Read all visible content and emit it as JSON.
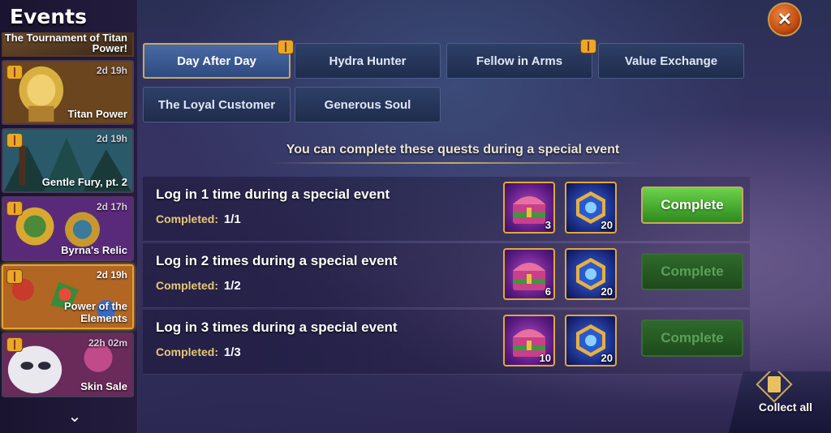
{
  "header": {
    "title": "Events"
  },
  "sidebar": {
    "items": [
      {
        "name": "The Tournament of Titan Power!",
        "timer": ""
      },
      {
        "name": "Titan Power",
        "timer": "2d 19h"
      },
      {
        "name": "Gentle Fury, pt. 2",
        "timer": "2d 19h"
      },
      {
        "name": "Byrna's Relic",
        "timer": "2d 17h"
      },
      {
        "name": "Power of the Elements",
        "timer": "2d 19h"
      },
      {
        "name": "Skin Sale",
        "timer": "22h 02m"
      }
    ]
  },
  "tabs": [
    {
      "label": "Day After Day",
      "active": true,
      "gift": true
    },
    {
      "label": "Hydra Hunter",
      "active": false,
      "gift": false
    },
    {
      "label": "Fellow in Arms",
      "active": false,
      "gift": true
    },
    {
      "label": "Value Exchange",
      "active": false,
      "gift": false
    },
    {
      "label": "The Loyal Customer",
      "active": false,
      "gift": false
    },
    {
      "label": "Generous Soul",
      "active": false,
      "gift": false
    }
  ],
  "subtitle": "You can complete these quests during a special event",
  "quests": [
    {
      "title": "Log in 1 time during a special event",
      "progress_label": "Completed:",
      "progress": "1/1",
      "rewards": [
        "3",
        "20"
      ],
      "button": "Complete",
      "enabled": true
    },
    {
      "title": "Log in 2 times during a special event",
      "progress_label": "Completed:",
      "progress": "1/2",
      "rewards": [
        "6",
        "20"
      ],
      "button": "Complete",
      "enabled": false
    },
    {
      "title": "Log in 3 times during a special event",
      "progress_label": "Completed:",
      "progress": "1/3",
      "rewards": [
        "10",
        "20"
      ],
      "button": "Complete",
      "enabled": false
    }
  ],
  "collect_all": "Collect all",
  "colors": {
    "accent_gold": "#e6a431",
    "complete_green": "#4cb536",
    "tab_blue": "#2e4068"
  },
  "icons": {
    "close": "close-icon",
    "gift": "gift-icon",
    "chest": "chest-icon",
    "emerald": "emerald-icon",
    "scroll": "chevron-down-icon"
  }
}
